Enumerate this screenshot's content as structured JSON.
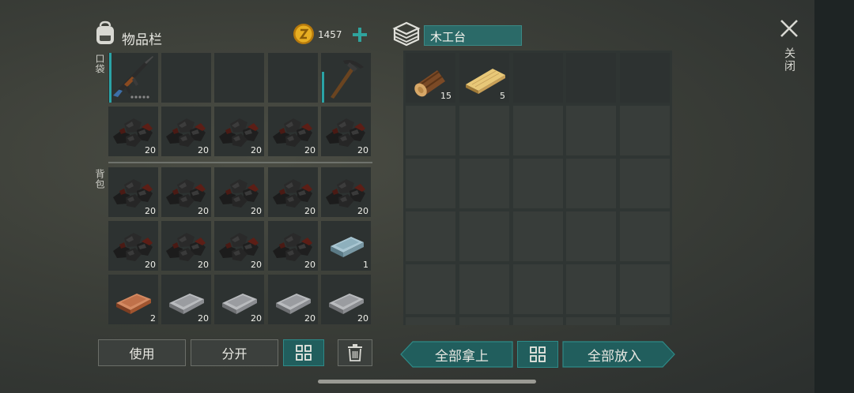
{
  "inventory": {
    "title": "物品栏",
    "coins": "1457",
    "pocket_label": "口袋",
    "backpack_label": "背包",
    "pocket_slots": [
      {
        "item": "ak-rifle",
        "count": ""
      },
      {
        "item": "",
        "count": ""
      },
      {
        "item": "",
        "count": ""
      },
      {
        "item": "",
        "count": ""
      },
      {
        "item": "pickaxe",
        "count": ""
      },
      {
        "item": "coal",
        "count": "20"
      },
      {
        "item": "coal",
        "count": "20"
      },
      {
        "item": "coal",
        "count": "20"
      },
      {
        "item": "coal",
        "count": "20"
      },
      {
        "item": "coal",
        "count": "20"
      }
    ],
    "backpack_slots": [
      {
        "item": "coal",
        "count": "20"
      },
      {
        "item": "coal",
        "count": "20"
      },
      {
        "item": "coal",
        "count": "20"
      },
      {
        "item": "coal",
        "count": "20"
      },
      {
        "item": "coal",
        "count": "20"
      },
      {
        "item": "coal",
        "count": "20"
      },
      {
        "item": "coal",
        "count": "20"
      },
      {
        "item": "coal",
        "count": "20"
      },
      {
        "item": "coal",
        "count": "20"
      },
      {
        "item": "steel-bar",
        "count": "1"
      },
      {
        "item": "copper-bar",
        "count": "2"
      },
      {
        "item": "iron-bar",
        "count": "20"
      },
      {
        "item": "iron-bar",
        "count": "20"
      },
      {
        "item": "iron-bar",
        "count": "20"
      },
      {
        "item": "iron-bar",
        "count": "20"
      }
    ],
    "buttons": {
      "use": "使用",
      "split": "分开"
    }
  },
  "container": {
    "name": "木工台",
    "slots": [
      {
        "item": "log",
        "count": "15"
      },
      {
        "item": "plank",
        "count": "5"
      }
    ],
    "buttons": {
      "take_all": "全部拿上",
      "put_all": "全部放入"
    }
  },
  "close_label": "关闭",
  "colors": {
    "accent_teal": "#2a8a86",
    "coin_gold": "#e0a418",
    "durability": "#2aa3a6"
  }
}
